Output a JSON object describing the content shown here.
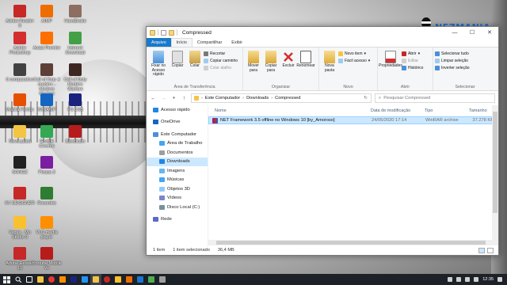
{
  "desktop": {
    "icons": [
      {
        "label": "Adobe Reader 9",
        "color": "#c62828"
      },
      {
        "label": "AIMP",
        "color": "#ef6c00"
      },
      {
        "label": "HandBrake",
        "color": "#8d6e63"
      },
      {
        "label": "Adobe Photoshop",
        "color": "#d32f2f"
      },
      {
        "label": "Avast Premier",
        "color": "#ff6f00"
      },
      {
        "label": "Internet Download",
        "color": "#43a047"
      },
      {
        "label": "0 comparativo",
        "color": "#424242"
      },
      {
        "label": "Call of Duty 4 modern - Modern Warfare",
        "color": "#5d4037"
      },
      {
        "label": "Call of Duty Modern Warfare",
        "color": "#3e2723"
      },
      {
        "label": "Mozilla Firefox",
        "color": "#e65100"
      },
      {
        "label": "WINAMP",
        "color": "#1565c0"
      },
      {
        "label": "PS CS5",
        "color": "#1a237e"
      },
      {
        "label": "Nova pasta",
        "color": "#f4c542"
      },
      {
        "label": "Google Chrome",
        "color": "#34a853"
      },
      {
        "label": "Bandicam",
        "color": "#b71c1c"
      },
      {
        "label": "SONGZ",
        "color": "#212121"
      },
      {
        "label": "Picasa 3",
        "color": "#7b1fa2"
      },
      {
        "label": "KV DESIGNER",
        "color": "#c62828"
      },
      {
        "label": "Recordes",
        "color": "#2e7d32"
      },
      {
        "label": "Vegas - Mo Studio 9",
        "color": "#fbc02d"
      },
      {
        "label": "VLC media player",
        "color": "#ff8f00"
      },
      {
        "label": "Adobe Reader 10",
        "color": "#c62828"
      },
      {
        "label": "Youtube Mobile Ve",
        "color": "#b71c1c"
      }
    ]
  },
  "watermark": {
    "text": "NEZMANIA"
  },
  "window": {
    "title": "Compressed",
    "controls": {
      "minimize": "—",
      "maximize": "☐",
      "close": "✕"
    },
    "tabs": [
      {
        "label": "Arquivo"
      },
      {
        "label": "Início"
      },
      {
        "label": "Compartilhar"
      },
      {
        "label": "Exibir"
      }
    ],
    "ribbon": {
      "clipboard": {
        "pin": "Fixar no Acesso rápido",
        "copy": "Copiar",
        "paste": "Colar",
        "cut": "Recortar",
        "copy_path": "Copiar caminho",
        "paste_shortcut": "Colar atalho",
        "group": "Área de Transferência"
      },
      "organize": {
        "move_to": "Mover para",
        "copy_to": "Copiar para",
        "delete": "Excluir",
        "rename": "Renomear",
        "group": "Organizar"
      },
      "new": {
        "new_folder": "Nova pasta",
        "new_item": "Novo item",
        "easy_access": "Fácil acesso",
        "group": "Novo"
      },
      "open": {
        "properties": "Propriedades",
        "open": "Abrir",
        "edit": "Editar",
        "history": "Histórico",
        "group": "Abrir"
      },
      "select": {
        "select_all": "Selecionar tudo",
        "select_none": "Limpar seleção",
        "invert": "Inverter seleção",
        "group": "Selecionar"
      }
    },
    "address": {
      "parts": [
        "Este Computador",
        "Downloads",
        "Compressed"
      ],
      "search_placeholder": "Pesquisar Compressed"
    },
    "nav": [
      {
        "label": "Acesso rápido",
        "color": "#1e88e5",
        "indent": 0
      },
      {
        "label": "OneDrive",
        "color": "#1565c0",
        "indent": 0
      },
      {
        "label": "Este Computador",
        "color": "#4a90d9",
        "indent": 0
      },
      {
        "label": "Área de Trabalho",
        "color": "#42a5f5",
        "indent": 1
      },
      {
        "label": "Documentos",
        "color": "#9e9e9e",
        "indent": 1
      },
      {
        "label": "Downloads",
        "color": "#1e88e5",
        "indent": 1,
        "selected": true
      },
      {
        "label": "Imagens",
        "color": "#64b5f6",
        "indent": 1
      },
      {
        "label": "Músicas",
        "color": "#42a5f5",
        "indent": 1
      },
      {
        "label": "Objetos 3D",
        "color": "#90caf9",
        "indent": 1
      },
      {
        "label": "Vídeos",
        "color": "#7986cb",
        "indent": 1
      },
      {
        "label": "Disco Local (C:)",
        "color": "#78909c",
        "indent": 1
      },
      {
        "label": "Rede",
        "color": "#5c6bc0",
        "indent": 0
      }
    ],
    "columns": {
      "name": "Nome",
      "date": "Data de modificação",
      "type": "Tipo",
      "size": "Tamanho"
    },
    "files": [
      {
        "name": "NET Framework 3.5 offline no Windows 10 [by_Amoroso]",
        "date": "24/05/2020 17:14",
        "type": "WinRAR archive",
        "size": "37.278 KB"
      }
    ],
    "status": {
      "count": "1 item",
      "selected": "1 item selecionado",
      "size": "36,4 MB"
    }
  },
  "taskbar": {
    "time": "12:35"
  }
}
